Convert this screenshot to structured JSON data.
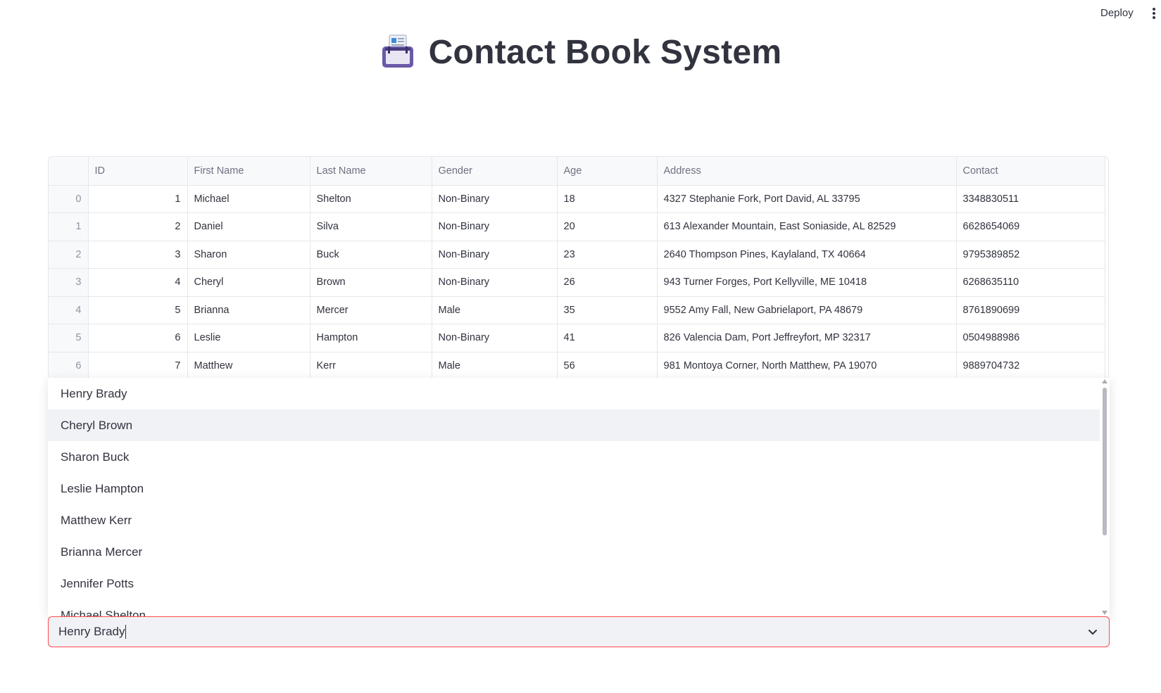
{
  "header": {
    "deploy_label": "Deploy",
    "menu_icon": "kebab-menu-icon"
  },
  "page": {
    "title": "Contact Book System",
    "title_icon": "card-index-icon"
  },
  "table": {
    "columns": [
      "",
      "ID",
      "First Name",
      "Last Name",
      "Gender",
      "Age",
      "Address",
      "Contact"
    ],
    "rows": [
      {
        "index": "0",
        "id": "1",
        "first": "Michael",
        "last": "Shelton",
        "gender": "Non-Binary",
        "age": "18",
        "address": "4327 Stephanie Fork, Port David, AL 33795",
        "contact": "3348830511"
      },
      {
        "index": "1",
        "id": "2",
        "first": "Daniel",
        "last": "Silva",
        "gender": "Non-Binary",
        "age": "20",
        "address": "613 Alexander Mountain, East Soniaside, AL 82529",
        "contact": "6628654069"
      },
      {
        "index": "2",
        "id": "3",
        "first": "Sharon",
        "last": "Buck",
        "gender": "Non-Binary",
        "age": "23",
        "address": "2640 Thompson Pines, Kaylaland, TX 40664",
        "contact": "9795389852"
      },
      {
        "index": "3",
        "id": "4",
        "first": "Cheryl",
        "last": "Brown",
        "gender": "Non-Binary",
        "age": "26",
        "address": "943 Turner Forges, Port Kellyville, ME 10418",
        "contact": "6268635110"
      },
      {
        "index": "4",
        "id": "5",
        "first": "Brianna",
        "last": "Mercer",
        "gender": "Male",
        "age": "35",
        "address": "9552 Amy Fall, New Gabrielaport, PA 48679",
        "contact": "8761890699"
      },
      {
        "index": "5",
        "id": "6",
        "first": "Leslie",
        "last": "Hampton",
        "gender": "Non-Binary",
        "age": "41",
        "address": "826 Valencia Dam, Port Jeffreyfort, MP 32317",
        "contact": "0504988986"
      },
      {
        "index": "6",
        "id": "7",
        "first": "Matthew",
        "last": "Kerr",
        "gender": "Male",
        "age": "56",
        "address": "981 Montoya Corner, North Matthew, PA 19070",
        "contact": "9889704732"
      }
    ]
  },
  "dropdown": {
    "options": [
      "Henry Brady",
      "Cheryl Brown",
      "Sharon Buck",
      "Leslie Hampton",
      "Matthew Kerr",
      "Brianna Mercer",
      "Jennifer Potts",
      "Michael Shelton"
    ],
    "highlighted": "Cheryl Brown"
  },
  "select": {
    "value": "Henry Brady",
    "chevron_icon": "chevron-down-icon",
    "border_color": "#ff4b4b"
  }
}
